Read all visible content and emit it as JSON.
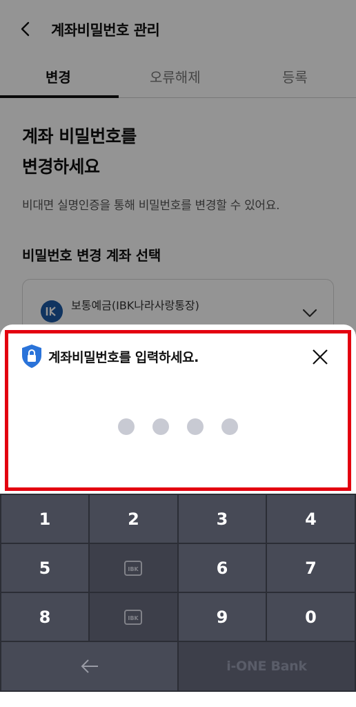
{
  "header": {
    "title": "계좌비밀번호 관리"
  },
  "tabs": [
    {
      "label": "변경",
      "active": true
    },
    {
      "label": "오류해제",
      "active": false
    },
    {
      "label": "등록",
      "active": false
    }
  ],
  "main": {
    "title_line1": "계좌 비밀번호를",
    "title_line2": "변경하세요",
    "description": "비대면 실명인증을 통해 비밀번호를 변경할 수 있어요.",
    "section_title": "비밀번호 변경 계좌 선택",
    "account_name": "보통예금(IBK나라사랑통장)"
  },
  "sheet": {
    "title": "계좌비밀번호를 입력하세요.",
    "entered_digits": 4
  },
  "keypad": {
    "keys": [
      "1",
      "2",
      "3",
      "4",
      "5",
      "",
      "6",
      "7",
      "8",
      "",
      "9",
      "0"
    ],
    "brand": "i-ONE Bank"
  },
  "colors": {
    "accent_red": "#e3000f",
    "keypad_bg": "#474a56",
    "shield_blue": "#2a73d9"
  }
}
